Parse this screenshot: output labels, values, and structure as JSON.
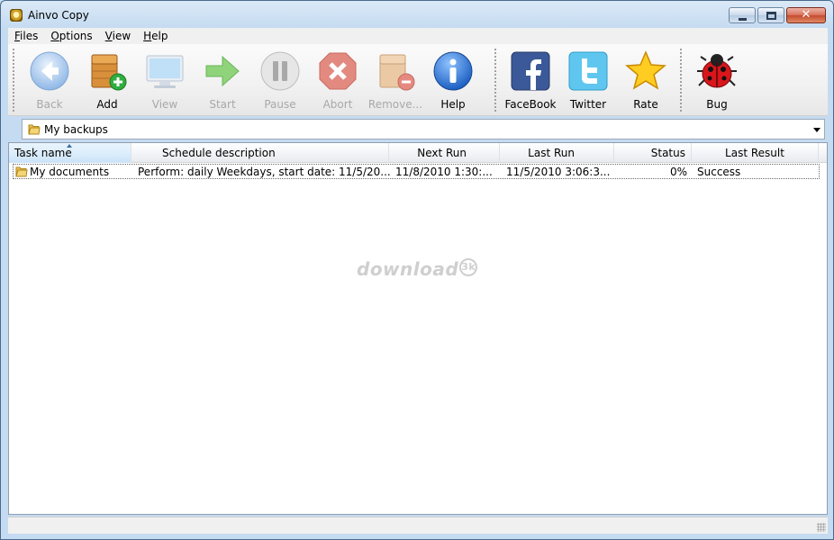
{
  "window": {
    "title": "Ainvo Copy",
    "close_glyph": "✕"
  },
  "menu": [
    {
      "label": "Files",
      "accel": "F",
      "rest": "iles"
    },
    {
      "label": "Options",
      "accel": "O",
      "rest": "ptions"
    },
    {
      "label": "View",
      "accel": "V",
      "rest": "iew"
    },
    {
      "label": "Help",
      "accel": "H",
      "rest": "elp"
    }
  ],
  "toolbar": {
    "back": {
      "label": "Back",
      "icon": "back-arrow-icon",
      "enabled": false
    },
    "add": {
      "label": "Add",
      "icon": "add-box-icon",
      "enabled": true
    },
    "view": {
      "label": "View",
      "icon": "monitor-icon",
      "enabled": false
    },
    "start": {
      "label": "Start",
      "icon": "start-arrow-icon",
      "enabled": false
    },
    "pause": {
      "label": "Pause",
      "icon": "pause-icon",
      "enabled": false
    },
    "abort": {
      "label": "Abort",
      "icon": "abort-x-icon",
      "enabled": false
    },
    "remove": {
      "label": "Remove...",
      "icon": "remove-box-icon",
      "enabled": false
    },
    "help": {
      "label": "Help",
      "icon": "info-icon",
      "enabled": true
    },
    "facebook": {
      "label": "FaceBook",
      "icon": "facebook-icon",
      "enabled": true
    },
    "twitter": {
      "label": "Twitter",
      "icon": "twitter-icon",
      "enabled": true
    },
    "rate": {
      "label": "Rate",
      "icon": "star-icon",
      "enabled": true
    },
    "bug": {
      "label": "Bug",
      "icon": "ladybug-icon",
      "enabled": true
    }
  },
  "path": {
    "value": "My backups",
    "icon": "folder-icon"
  },
  "table": {
    "columns": [
      "Task name",
      "Schedule description",
      "Next Run",
      "Last Run",
      "Status",
      "Last Result"
    ],
    "sorted_column": "Task name",
    "rows": [
      {
        "task_name": "My documents",
        "schedule": "Perform: daily Weekdays, start date: 11/5/20...",
        "next_run": "11/8/2010 1:30:...",
        "last_run": "11/5/2010 3:06:3...",
        "status": "0%",
        "last_result": "Success"
      }
    ]
  },
  "watermark": {
    "text": "download",
    "badge": "3k"
  },
  "colors": {
    "accent": "#3a7bd5",
    "titlebar": "#c5dbf1",
    "close": "#c44a2e"
  }
}
